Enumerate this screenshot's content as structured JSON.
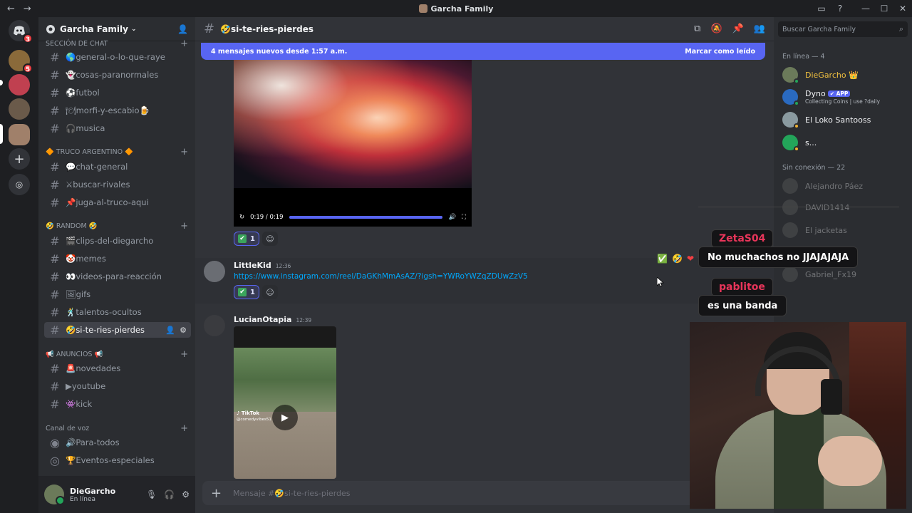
{
  "titlebar": {
    "title": "Garcha Family",
    "back": "←",
    "forward": "→",
    "min": "—",
    "max": "☐",
    "close": "✕"
  },
  "servers": [
    {
      "name": "Discord",
      "badge": "3",
      "color": "#5865f2"
    },
    {
      "name": "Server A",
      "badge": "5",
      "color": "#8a6a3a"
    },
    {
      "name": "Server B",
      "badge": "",
      "color": "#c04050"
    },
    {
      "name": "Server C",
      "badge": "",
      "color": "#6a5a4a"
    },
    {
      "name": "Garcha Family",
      "badge": "",
      "color": "#a0806a"
    }
  ],
  "guild": {
    "name": "Garcha Family"
  },
  "categories": {
    "seccion": "SECCIÓN DE CHAT",
    "truco": "🔶 TRUCO ARGENTINO 🔶",
    "random": "🤣 RANDOM 🤣",
    "anuncios": "📢 ANUNCIOS 📢",
    "voz": "Canal de voz"
  },
  "channels": {
    "general": "🌎general-o-lo-que-raye",
    "paranormales": "👻cosas-paranormales",
    "futbol": "⚽futbol",
    "morfi": "🍽morfi-y-escabio🍺",
    "musica": "🎧musica",
    "chatgeneral": "💬chat-general",
    "rivales": "⚔buscar-rivales",
    "juga": "📌juga-al-truco-aqui",
    "clips": "🎬clips-del-diegarcho",
    "memes": "🤡memes",
    "videos": "👀videos-para-reacción",
    "gifs": "🖼gifs",
    "talentos": "🕺talentos-ocultos",
    "sitereies": "🤣si-te-ries-pierdes",
    "novedades": "🚨novedades",
    "youtube": "▶youtube",
    "kick": "👾kick",
    "paratodos": "🔊Para-todos",
    "eventos": "🏆Eventos-especiales"
  },
  "user": {
    "name": "DieGarcho",
    "status": "En línea"
  },
  "header": {
    "channel": "🤣si-te-ries-pierdes"
  },
  "newbar": {
    "text": "4 mensajes nuevos desde 1:57 a.m.",
    "mark": "Marcar como leído"
  },
  "video": {
    "time": "0:19 / 0:19",
    "progress": 1.0
  },
  "reaction1": {
    "count": "1"
  },
  "reaction2": {
    "count": "1"
  },
  "messages": [
    {
      "author": "LittleKid",
      "time": "12:36",
      "link": "https://www.instagram.com/reel/DaGKhMmAsAZ/?igsh=YWRoYWZqZDUwZzV5"
    },
    {
      "author": "LucianOtapia",
      "time": "12:39"
    }
  ],
  "tiktok": {
    "logo": "♪ TikTok",
    "handle": "@comedyvibes51"
  },
  "composer": {
    "placeholder": "Mensaje #🤣si-te-ries-pierdes"
  },
  "members": {
    "search": "Buscar Garcha Family",
    "online_header": "En línea — 4",
    "offline_header": "Sin conexión — 22",
    "online": [
      {
        "name": "DieGarcho 👑",
        "sub": "",
        "color": "#6b7a5a",
        "status": "#23a55a"
      },
      {
        "name": "Dyno",
        "sub": "Collecting Coins | use ?daily",
        "color": "#2a6ac0",
        "status": "#23a55a",
        "app": "✔ APP"
      },
      {
        "name": "El Loko Santooss",
        "sub": "",
        "color": "#8a9aa0",
        "status": "#f0b232"
      },
      {
        "name": "s...",
        "sub": "",
        "color": "#23a55a",
        "status": "#f0b232"
      }
    ],
    "offline": [
      "Alejandro Páez",
      "DAVID1414",
      "El jacketas",
      "Gabriel_Fx19"
    ]
  },
  "overlay": {
    "users": [
      {
        "name": "ZetaS04",
        "color": "#e8355a"
      },
      {
        "name": "pablitoe",
        "color": "#e8355a"
      }
    ],
    "messages": [
      "No muchachos no JJAJAJAJA",
      "es una banda"
    ]
  }
}
